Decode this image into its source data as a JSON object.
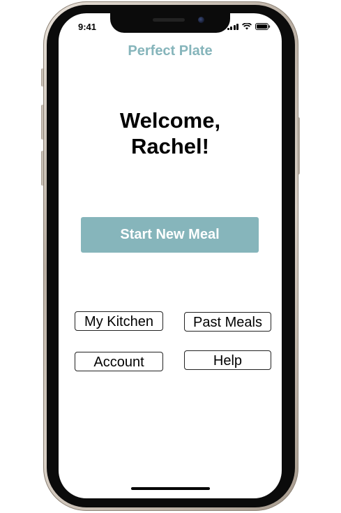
{
  "status_bar": {
    "time": "9:41",
    "icons": [
      "signal-icon",
      "wifi-icon",
      "battery-icon"
    ]
  },
  "app": {
    "title": "Perfect Plate",
    "welcome_line1": "Welcome,",
    "welcome_line2": "Rachel!",
    "start_button_label": "Start New Meal",
    "nav": {
      "my_kitchen": "My Kitchen",
      "past_meals": "Past Meals",
      "account": "Account",
      "help": "Help"
    }
  },
  "colors": {
    "accent": "#86b5bb",
    "text": "#000000",
    "background": "#ffffff"
  }
}
